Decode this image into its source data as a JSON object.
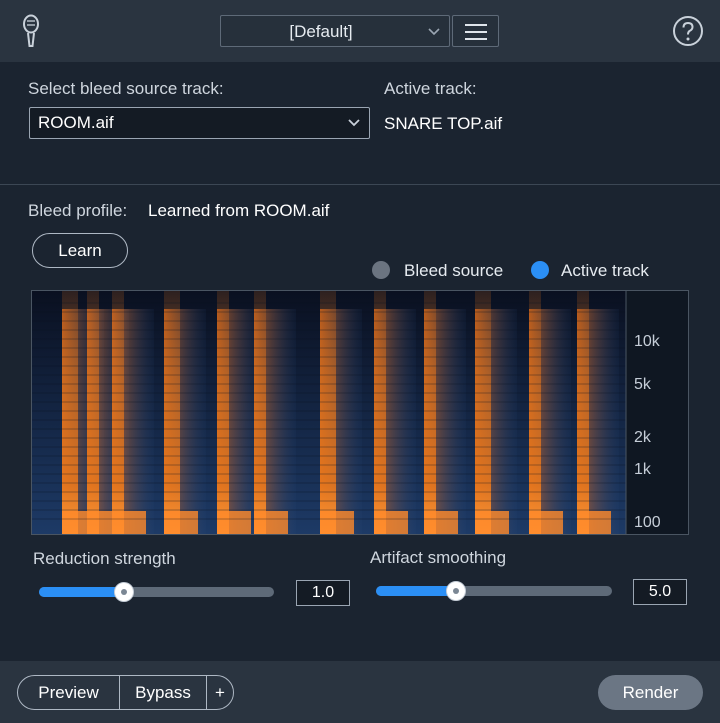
{
  "header": {
    "preset_value": "[Default]",
    "icons": {
      "mic": "microphone-icon",
      "menu": "hamburger-menu-icon",
      "help": "help-icon"
    }
  },
  "source": {
    "label": "Select bleed source track:",
    "selected": "ROOM.aif"
  },
  "active": {
    "label": "Active track:",
    "value": "SNARE TOP.aif"
  },
  "profile": {
    "label": "Bleed profile:",
    "value": "Learned from ROOM.aif",
    "learn_label": "Learn"
  },
  "legend": {
    "bleed_source": "Bleed source",
    "active_track": "Active track",
    "bleed_color": "#6b7480",
    "active_color": "#2b8ff5"
  },
  "spectrogram": {
    "freq_ticks": [
      "10k",
      "5k",
      "2k",
      "1k",
      "100"
    ],
    "colors": {
      "background": "#0d1626",
      "energy": "#f07a1a"
    }
  },
  "controls": {
    "reduction": {
      "label": "Reduction strength",
      "value": "1.0",
      "level": 0.36
    },
    "smoothing": {
      "label": "Artifact smoothing",
      "value": "5.0",
      "level": 0.34
    }
  },
  "footer": {
    "preview_label": "Preview",
    "bypass_label": "Bypass",
    "add_label": "+",
    "render_label": "Render"
  }
}
